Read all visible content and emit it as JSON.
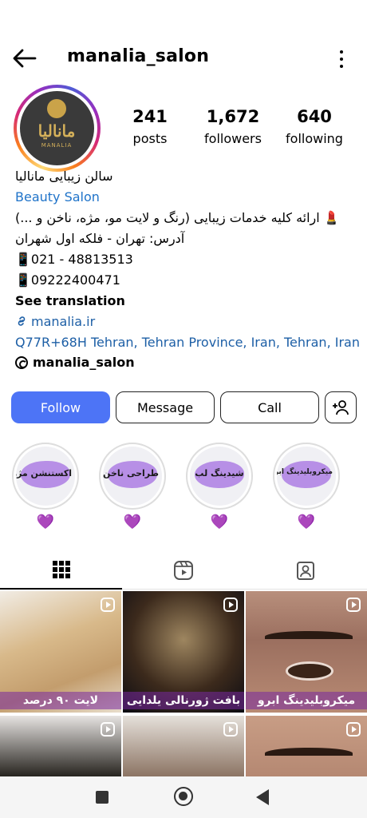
{
  "header": {
    "username": "manalia_salon",
    "back_icon": "arrow-left-icon",
    "more_icon": "more-vertical-icon"
  },
  "avatar": {
    "logo_text": "مانالیا",
    "logo_subtext": "MANALIA"
  },
  "stats": {
    "posts": {
      "count": "241",
      "label": "posts"
    },
    "followers": {
      "count": "1,672",
      "label": "followers"
    },
    "following": {
      "count": "640",
      "label": "following"
    }
  },
  "bio": {
    "name": "سالن زیبایی مانالیا",
    "category": "Beauty Salon",
    "description": "💄 ارائه کلیه خدمات زیبایی (رنگ و لایت مو، مژه، ناخن و ...)",
    "address": "آدرس: تهران - فلکه اول شهران",
    "phone1": "📱021 - 48813513",
    "phone2": "📱09222400471",
    "see_translation": "See translation",
    "website": "manalia.ir",
    "location": "Q77R+68H Tehran, Tehran Province, Iran, Tehran, Iran",
    "threads_handle": "manalia_salon"
  },
  "buttons": {
    "follow": "Follow",
    "message": "Message",
    "call": "Call"
  },
  "highlights": [
    {
      "title": "اکستنشن مژه",
      "emoji": "💜"
    },
    {
      "title": "طراحی ناخن",
      "emoji": "💜"
    },
    {
      "title": "شیدینگ لب",
      "emoji": "💜"
    },
    {
      "title": "میکروبلیدینگ ابرو",
      "emoji": "💜"
    }
  ],
  "tabs": [
    {
      "name": "grid",
      "icon": "grid-icon"
    },
    {
      "name": "reels",
      "icon": "reels-icon"
    },
    {
      "name": "tagged",
      "icon": "tagged-user-icon"
    }
  ],
  "posts": [
    {
      "caption": "لایت ۹۰ درصد"
    },
    {
      "caption": "بافت ژورنالی یلدایی"
    },
    {
      "caption": "میکروبلیدینگ ابرو"
    },
    {
      "caption": ""
    },
    {
      "caption": ""
    },
    {
      "caption": ""
    }
  ],
  "colors": {
    "follow_button": "#4d74f6",
    "link": "#1d5fa6",
    "category": "#1f73c9"
  }
}
